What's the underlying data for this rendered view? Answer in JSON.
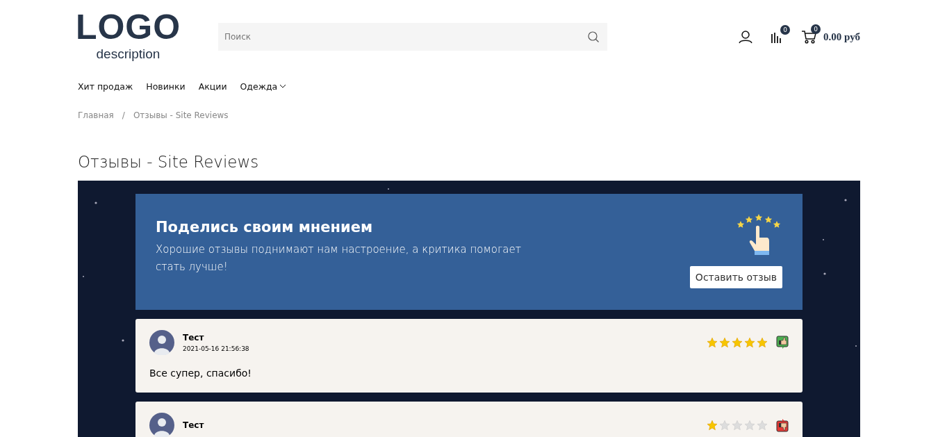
{
  "logo": {
    "title": "LOGO",
    "description": "description"
  },
  "search": {
    "placeholder": "Поиск"
  },
  "header_icons": [
    {
      "kind": "user"
    },
    {
      "kind": "compare",
      "badge": "0"
    },
    {
      "kind": "cart",
      "badge": "0",
      "label": "0.00 руб"
    }
  ],
  "nav": [
    {
      "label": "Хит продаж",
      "dropdown": false
    },
    {
      "label": "Новинки",
      "dropdown": false
    },
    {
      "label": "Акции",
      "dropdown": false
    },
    {
      "label": "Одежда",
      "dropdown": true
    }
  ],
  "breadcrumbs": [
    "Главная",
    "Отзывы - Site Reviews"
  ],
  "breadcrumb_separator": "/",
  "page_title": "Отзывы - Site Reviews",
  "banner": {
    "title": "Поделись своим мнением",
    "text": "Хорошие отзывы поднимают нам настроение, а критика помогает стать лучше!",
    "button": "Оставить отзыв"
  },
  "reviews": [
    {
      "name": "Тест",
      "date": "2021-05-16 21:56:38",
      "stars": 5,
      "positive": true,
      "text": "Все супер, спасибо!"
    },
    {
      "name": "Тест",
      "stars": 1,
      "positive": false
    }
  ]
}
